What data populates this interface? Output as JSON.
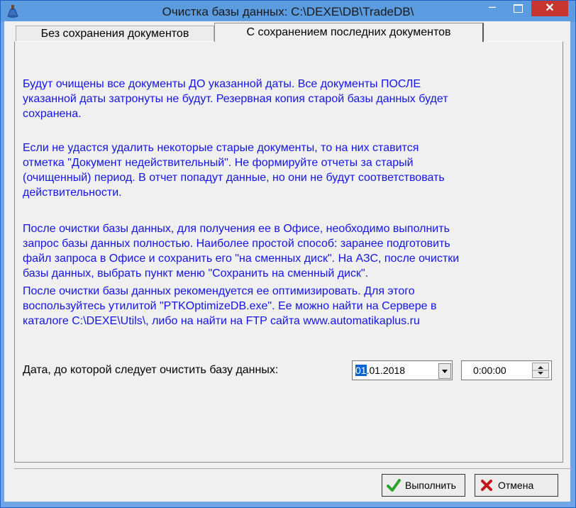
{
  "window": {
    "title": "Очистка базы данных: C:\\DEXE\\DB\\TradeDB\\",
    "minimize": "–",
    "close": "✕"
  },
  "tabs": [
    {
      "label": "Без сохранения документов",
      "active": false
    },
    {
      "label": "С сохранением последних документов",
      "active": true
    }
  ],
  "info": {
    "p1": "Будут очищены все документы ДО указанной даты. Все документы ПОСЛЕ\nуказанной даты затронуты не будут. Резервная копия старой базы данных будет\nсохранена.",
    "p2": "Если не удастся удалить некоторые старые документы, то на них ставится\nотметка \"Документ недействительный\". Не формируйте отчеты за старый\n(очищенный) период. В отчет попадут данные, но они не будут соответствовать\nдействительности.",
    "p3": "После очистки базы данных, для получения ее в Офисе, необходимо выполнить\nзапрос базы данных полностью. Наиболее простой способ: заранее подготовить\nфайл запроса в Офисе и сохранить его \"на сменных диск\". На АЗС, после очистки\nбазы данных, выбрать пункт меню \"Сохранить на сменный диск\".",
    "p4": "После очистки базы данных рекомендуется ее оптимизировать. Для этого\nвоспользуйтесь утилитой \"PTKOptimizeDB.exe\". Ее можно найти на Сервере в\nкаталоге C:\\DEXE\\Utils\\, либо на найти на FTP сайта www.automatikaplus.ru"
  },
  "date_label": "Дата, до которой следует очистить базу данных:",
  "date": {
    "selected": "01",
    "rest": ".01.2018"
  },
  "time": "0:00:00",
  "buttons": {
    "run": "Выполнить",
    "cancel": "Отмена"
  },
  "colors": {
    "info_text": "#1414e6",
    "title_bar": "#5b9be0",
    "close": "#c7352f"
  },
  "icons": {
    "app": "flask-icon",
    "run": "checkmark-icon",
    "cancel": "x-icon"
  }
}
